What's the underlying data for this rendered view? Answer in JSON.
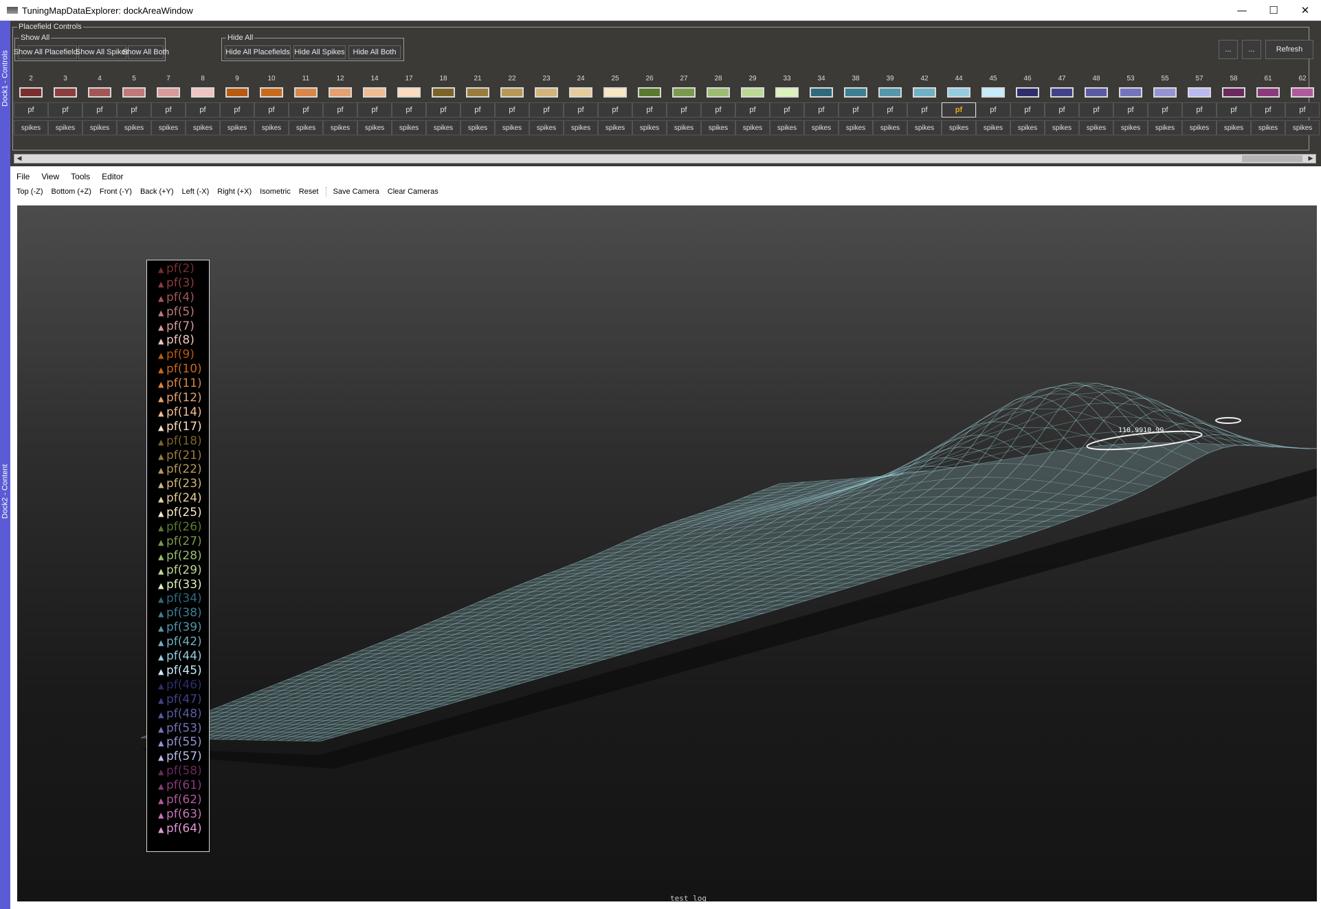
{
  "window": {
    "title": "TuningMapDataExplorer: dockAreaWindow",
    "minimize": "—",
    "maximize": "☐",
    "close": "✕"
  },
  "docks": {
    "controls_tab": "Dock1 - Controls",
    "content_tab": "Dock2 - Content"
  },
  "controls": {
    "group_title": "Placefield Controls",
    "show_all": {
      "title": "Show All",
      "buttons": [
        "Show All Placefields",
        "Show All Spikes",
        "Show All Both"
      ]
    },
    "hide_all": {
      "title": "Hide All",
      "buttons": [
        "Hide All Placefields",
        "Hide All Spikes",
        "Hide All Both"
      ]
    },
    "right_buttons": [
      "...",
      "...",
      "Refresh"
    ],
    "pf_label": "pf",
    "spikes_label": "spikes",
    "active_cell": "44",
    "cells": [
      {
        "id": "2",
        "color": "#7a2e2e"
      },
      {
        "id": "3",
        "color": "#8c3d3d"
      },
      {
        "id": "4",
        "color": "#a35656"
      },
      {
        "id": "5",
        "color": "#c07878"
      },
      {
        "id": "7",
        "color": "#d99a9a"
      },
      {
        "id": "8",
        "color": "#f0c4c0"
      },
      {
        "id": "9",
        "color": "#b85a10"
      },
      {
        "id": "10",
        "color": "#c86a1e"
      },
      {
        "id": "11",
        "color": "#d8864a"
      },
      {
        "id": "12",
        "color": "#e4a070"
      },
      {
        "id": "14",
        "color": "#f0bc94"
      },
      {
        "id": "17",
        "color": "#fcdcc0"
      },
      {
        "id": "18",
        "color": "#7c6428"
      },
      {
        "id": "21",
        "color": "#9a7c3c"
      },
      {
        "id": "22",
        "color": "#b8985a"
      },
      {
        "id": "23",
        "color": "#d2b47c"
      },
      {
        "id": "24",
        "color": "#e6cc9c"
      },
      {
        "id": "25",
        "color": "#f8e8c4"
      },
      {
        "id": "26",
        "color": "#5a7a30"
      },
      {
        "id": "27",
        "color": "#7a9a4e"
      },
      {
        "id": "28",
        "color": "#9cbc70"
      },
      {
        "id": "29",
        "color": "#bcd894"
      },
      {
        "id": "33",
        "color": "#dcf2bc"
      },
      {
        "id": "34",
        "color": "#2e6a7c"
      },
      {
        "id": "38",
        "color": "#3e7e92"
      },
      {
        "id": "39",
        "color": "#5496aa"
      },
      {
        "id": "42",
        "color": "#70b0c4"
      },
      {
        "id": "44",
        "color": "#94cce0"
      },
      {
        "id": "45",
        "color": "#c4ecfa"
      },
      {
        "id": "46",
        "color": "#2e2e6c"
      },
      {
        "id": "47",
        "color": "#42428a"
      },
      {
        "id": "48",
        "color": "#5a5aa4"
      },
      {
        "id": "53",
        "color": "#7474bc"
      },
      {
        "id": "55",
        "color": "#9494d4"
      },
      {
        "id": "57",
        "color": "#babaf0"
      },
      {
        "id": "58",
        "color": "#6a2a5e"
      },
      {
        "id": "61",
        "color": "#8c3a7c"
      },
      {
        "id": "62",
        "color": "#b05a9e"
      }
    ]
  },
  "menubar": [
    "File",
    "View",
    "Tools",
    "Editor"
  ],
  "camera_toolbar": {
    "views": [
      "Top (-Z)",
      "Bottom (+Z)",
      "Front (-Y)",
      "Back (+Y)",
      "Left (-X)",
      "Right (+X)",
      "Isometric",
      "Reset"
    ],
    "actions": [
      "Save Camera",
      "Clear Cameras"
    ]
  },
  "viewport": {
    "peak_label": "110.9910.99",
    "status_log": "test log",
    "mesh_color": "#9fd4dc",
    "legend": [
      {
        "label": "pf(2)",
        "color": "#7a2e2e"
      },
      {
        "label": "pf(3)",
        "color": "#8c3d3d"
      },
      {
        "label": "pf(4)",
        "color": "#a35656"
      },
      {
        "label": "pf(5)",
        "color": "#c07878"
      },
      {
        "label": "pf(7)",
        "color": "#d99a9a"
      },
      {
        "label": "pf(8)",
        "color": "#f0c4c0"
      },
      {
        "label": "pf(9)",
        "color": "#b85a10"
      },
      {
        "label": "pf(10)",
        "color": "#c86a1e"
      },
      {
        "label": "pf(11)",
        "color": "#d8864a"
      },
      {
        "label": "pf(12)",
        "color": "#e4a070"
      },
      {
        "label": "pf(14)",
        "color": "#f0bc94"
      },
      {
        "label": "pf(17)",
        "color": "#fcdcc0"
      },
      {
        "label": "pf(18)",
        "color": "#7c6428"
      },
      {
        "label": "pf(21)",
        "color": "#9a7c3c"
      },
      {
        "label": "pf(22)",
        "color": "#b8985a"
      },
      {
        "label": "pf(23)",
        "color": "#d2b47c"
      },
      {
        "label": "pf(24)",
        "color": "#e6cc9c"
      },
      {
        "label": "pf(25)",
        "color": "#f8e8c4"
      },
      {
        "label": "pf(26)",
        "color": "#5a7a30"
      },
      {
        "label": "pf(27)",
        "color": "#7a9a4e"
      },
      {
        "label": "pf(28)",
        "color": "#9cbc70"
      },
      {
        "label": "pf(29)",
        "color": "#bcd894"
      },
      {
        "label": "pf(33)",
        "color": "#dcf2bc"
      },
      {
        "label": "pf(34)",
        "color": "#2e6a7c"
      },
      {
        "label": "pf(38)",
        "color": "#3e7e92"
      },
      {
        "label": "pf(39)",
        "color": "#5496aa"
      },
      {
        "label": "pf(42)",
        "color": "#70b0c4"
      },
      {
        "label": "pf(44)",
        "color": "#94cce0"
      },
      {
        "label": "pf(45)",
        "color": "#c4ecfa"
      },
      {
        "label": "pf(46)",
        "color": "#2e2e6c"
      },
      {
        "label": "pf(47)",
        "color": "#42428a"
      },
      {
        "label": "pf(48)",
        "color": "#5a5aa4"
      },
      {
        "label": "pf(53)",
        "color": "#7474bc"
      },
      {
        "label": "pf(55)",
        "color": "#9494d4"
      },
      {
        "label": "pf(57)",
        "color": "#babaf0"
      },
      {
        "label": "pf(58)",
        "color": "#6a2a5e"
      },
      {
        "label": "pf(61)",
        "color": "#8c3a7c"
      },
      {
        "label": "pf(62)",
        "color": "#b05a9e"
      },
      {
        "label": "pf(63)",
        "color": "#c874b8"
      },
      {
        "label": "pf(64)",
        "color": "#e098d4"
      }
    ]
  }
}
